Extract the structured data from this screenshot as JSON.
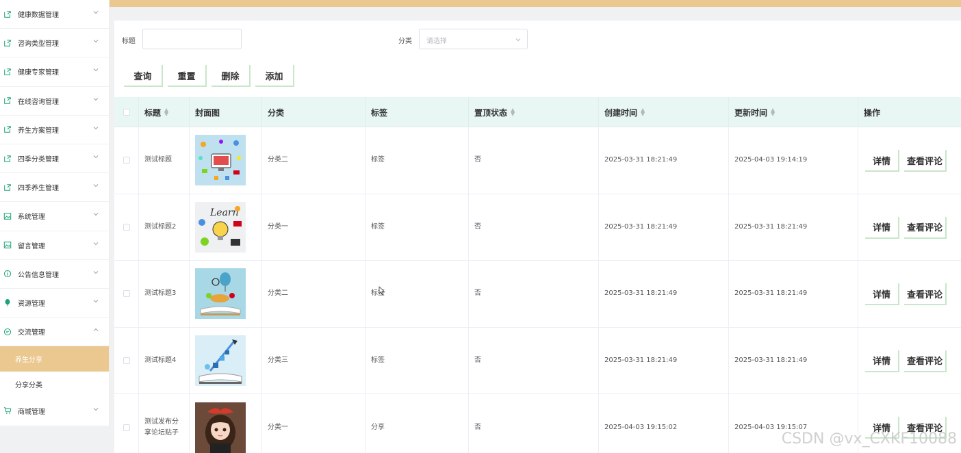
{
  "colors": {
    "accent": "#ecc891",
    "header_bg": "#e8f7f4",
    "button_shadow": "#c8e6c9",
    "icon": "#1aa37a"
  },
  "sidebar": {
    "items": [
      {
        "label": "健康数据管理",
        "icon": "doc-icon"
      },
      {
        "label": "咨询类型管理",
        "icon": "doc-icon"
      },
      {
        "label": "健康专家管理",
        "icon": "doc-icon"
      },
      {
        "label": "在线咨询管理",
        "icon": "doc-icon"
      },
      {
        "label": "养生方案管理",
        "icon": "doc-icon"
      },
      {
        "label": "四季分类管理",
        "icon": "doc-icon"
      },
      {
        "label": "四季养生管理",
        "icon": "doc-icon"
      },
      {
        "label": "系统管理",
        "icon": "picture-icon"
      },
      {
        "label": "留言管理",
        "icon": "picture-icon"
      },
      {
        "label": "公告信息管理",
        "icon": "info-icon"
      },
      {
        "label": "资源管理",
        "icon": "balloon-icon"
      },
      {
        "label": "交流管理",
        "icon": "chat-icon",
        "expanded": true
      }
    ],
    "sub_items": [
      {
        "label": "养生分享",
        "active": true
      },
      {
        "label": "分享分类",
        "active": false
      }
    ],
    "last_item": {
      "label": "商城管理",
      "icon": "cart-icon"
    }
  },
  "search": {
    "title_label": "标题",
    "title_value": "",
    "category_label": "分类",
    "category_placeholder": "请选择"
  },
  "toolbar": {
    "query": "查询",
    "reset": "重置",
    "delete": "删除",
    "add": "添加"
  },
  "table": {
    "headers": {
      "title": "标题",
      "cover": "封面图",
      "category": "分类",
      "tag": "标签",
      "pinned": "置顶状态",
      "created": "创建时间",
      "updated": "更新时间",
      "actions": "操作"
    },
    "action_labels": {
      "detail": "详情",
      "comments": "查看评论"
    },
    "rows": [
      {
        "title": "测试标题",
        "category": "分类二",
        "tag": "标签",
        "pinned": "否",
        "created": "2025-03-31 18:21:49",
        "updated": "2025-04-03 19:14:19",
        "cover": "computer-illustration"
      },
      {
        "title": "测试标题2",
        "category": "分类一",
        "tag": "标签",
        "pinned": "否",
        "created": "2025-03-31 18:21:49",
        "updated": "2025-03-31 18:21:49",
        "cover": "learn-lightbulb-illustration"
      },
      {
        "title": "测试标题3",
        "category": "分类二",
        "tag": "标签",
        "pinned": "否",
        "created": "2025-03-31 18:21:49",
        "updated": "2025-03-31 18:21:49",
        "cover": "book-balloon-illustration"
      },
      {
        "title": "测试标题4",
        "category": "分类三",
        "tag": "标签",
        "pinned": "否",
        "created": "2025-03-31 18:21:49",
        "updated": "2025-03-31 18:21:49",
        "cover": "book-rocket-illustration"
      },
      {
        "title": "测试发布分享论坛贴子",
        "category": "分类一",
        "tag": "分享",
        "pinned": "否",
        "created": "2025-04-03 19:15:02",
        "updated": "2025-04-03 19:15:07",
        "cover": "girl-portrait"
      }
    ]
  },
  "watermark": "CSDN @vx_CXKF10088"
}
